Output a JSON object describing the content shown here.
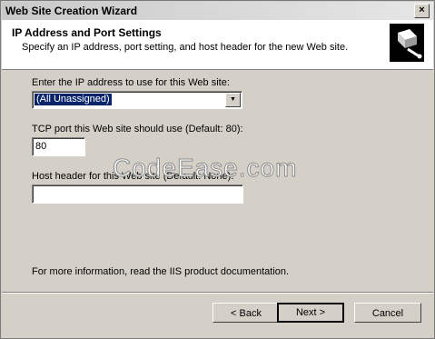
{
  "window": {
    "title": "Web Site Creation Wizard",
    "close_glyph": "×"
  },
  "header": {
    "title": "IP Address and Port Settings",
    "subtitle": "Specify an IP address, port setting, and host header for the new Web site.",
    "icon": "wizard-book-icon"
  },
  "ip": {
    "label": "Enter the IP address to use for this Web site:",
    "selected": "(All Unassigned)"
  },
  "port": {
    "label": "TCP port this Web site should use (Default: 80):",
    "value": "80"
  },
  "host": {
    "label": "Host header for this Web site (Default: None):",
    "value": ""
  },
  "info": "For more information, read the IIS product documentation.",
  "buttons": {
    "back": "< Back",
    "next": "Next >",
    "cancel": "Cancel"
  },
  "watermark": "CodeEase.com"
}
